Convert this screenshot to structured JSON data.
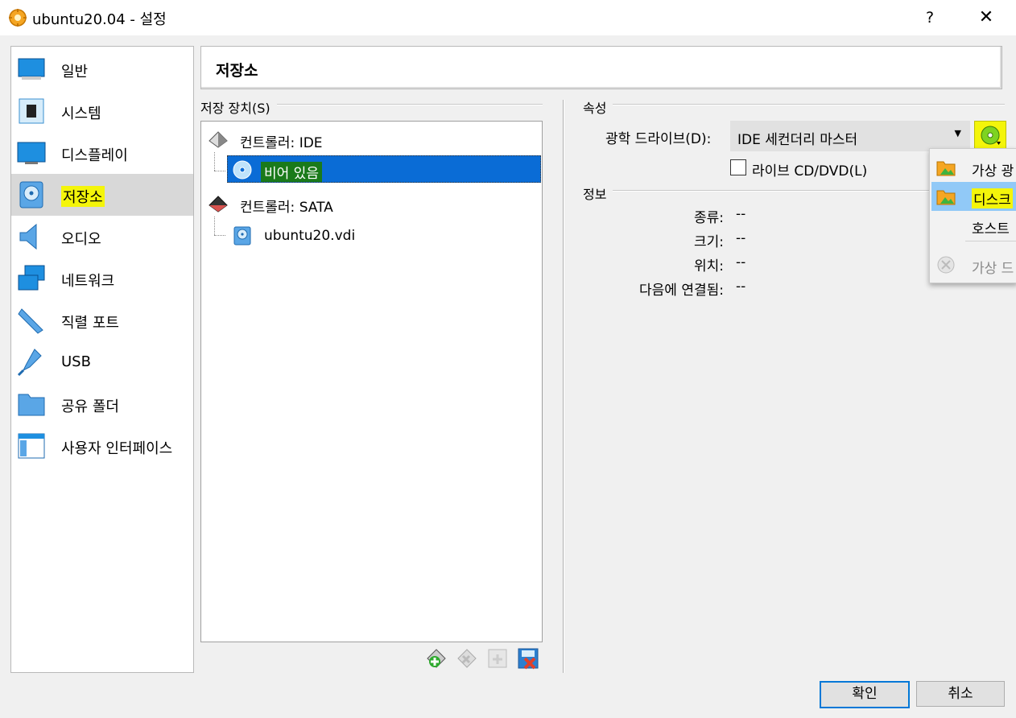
{
  "window": {
    "title": "ubuntu20.04 - 설정",
    "help_glyph": "?",
    "close_glyph": "✕"
  },
  "nav": {
    "items": [
      {
        "label": "일반",
        "icon": "general-icon"
      },
      {
        "label": "시스템",
        "icon": "system-icon"
      },
      {
        "label": "디스플레이",
        "icon": "display-icon"
      },
      {
        "label": "저장소",
        "icon": "storage-icon",
        "selected": true
      },
      {
        "label": "오디오",
        "icon": "audio-icon"
      },
      {
        "label": "네트워크",
        "icon": "network-icon"
      },
      {
        "label": "직렬 포트",
        "icon": "serial-port-icon"
      },
      {
        "label": "USB",
        "icon": "usb-icon"
      },
      {
        "label": "공유 폴더",
        "icon": "shared-folder-icon"
      },
      {
        "label": "사용자 인터페이스",
        "icon": "user-interface-icon"
      }
    ]
  },
  "page": {
    "title": "저장소"
  },
  "storage": {
    "group_label": "저장 장치(S)",
    "tree": [
      {
        "label": "컨트롤러: IDE",
        "icon": "ide-controller-icon"
      },
      {
        "label": "비어 있음",
        "icon": "optical-disc-icon",
        "selected": true
      },
      {
        "label": "컨트롤러: SATA",
        "icon": "sata-controller-icon"
      },
      {
        "label": "ubuntu20.vdi",
        "icon": "hard-disk-icon"
      }
    ],
    "toolbar": [
      "add-attachment-icon",
      "remove-attachment-icon",
      "add-controller-icon",
      "remove-controller-icon"
    ]
  },
  "attributes": {
    "group_label": "속성",
    "drive_label": "광학 드라이브(D):",
    "drive_value": "IDE 세컨더리 마스터",
    "live_cd_label": "라이브 CD/DVD(L)",
    "live_cd_checked": false
  },
  "info": {
    "group_label": "정보",
    "rows": [
      {
        "label": "종류:",
        "value": "--"
      },
      {
        "label": "크기:",
        "value": "--"
      },
      {
        "label": "위치:",
        "value": "--"
      },
      {
        "label": "다음에 연결됨:",
        "value": "--"
      }
    ]
  },
  "menu": {
    "items": [
      {
        "label": "가상 광",
        "icon": "folder-icon"
      },
      {
        "label": "디스크",
        "icon": "folder-icon",
        "hover": true
      },
      {
        "label": "호스트",
        "icon": ""
      },
      {
        "label": "가상 드",
        "icon": "remove-disc-icon",
        "disabled": true
      }
    ]
  },
  "buttons": {
    "ok": "확인",
    "cancel": "취소"
  },
  "colors": {
    "selection": "#0a6cd6",
    "highlight": "#f4f50a",
    "menu_hover": "#91c9f7"
  }
}
